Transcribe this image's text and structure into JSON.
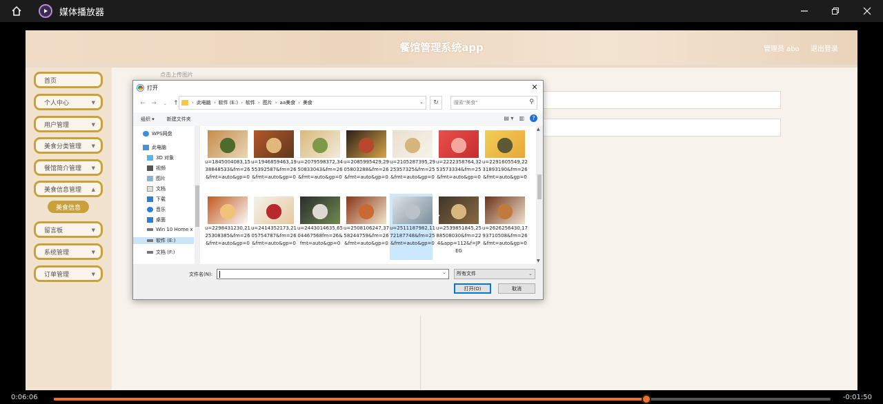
{
  "player": {
    "title": "媒体播放器",
    "time_elapsed": "0:06:06",
    "time_remaining": "-0:01:50",
    "progress": 0.763
  },
  "app": {
    "title": "餐馆管理系统app",
    "admin_label": "管理员 abo",
    "logout_label": "退出登录",
    "accent": "#c9a13a"
  },
  "sidebar": {
    "items": [
      {
        "label": "首页",
        "chevron": false
      },
      {
        "label": "个人中心",
        "chevron": true
      },
      {
        "label": "用户管理",
        "chevron": true
      },
      {
        "label": "美食分类管理",
        "chevron": true
      },
      {
        "label": "餐馆简介管理",
        "chevron": true
      },
      {
        "label": "美食信息管理",
        "chevron": true
      },
      {
        "label": "留言板",
        "chevron": true
      },
      {
        "label": "系统管理",
        "chevron": true
      },
      {
        "label": "订单管理",
        "chevron": true
      }
    ],
    "sub_item": "美食信息"
  },
  "main": {
    "crumb": "点击上传图片"
  },
  "dialog": {
    "title": "打开",
    "path": [
      "此电脑",
      "软件 (E:)",
      "软件",
      "图片",
      "aa美食",
      "美食"
    ],
    "search_placeholder": "搜索\"美食\"",
    "organize": "组织 ▾",
    "new_folder": "新建文件夹",
    "tree": [
      {
        "label": "WPS网盘",
        "icon": "cloud-icon"
      },
      {
        "label": "此电脑",
        "icon": "computer-icon"
      },
      {
        "label": "3D 对象",
        "icon": "cube-icon"
      },
      {
        "label": "视频",
        "icon": "video-icon"
      },
      {
        "label": "图片",
        "icon": "picture-icon"
      },
      {
        "label": "文档",
        "icon": "document-icon"
      },
      {
        "label": "下载",
        "icon": "download-icon"
      },
      {
        "label": "音乐",
        "icon": "music-icon"
      },
      {
        "label": "桌面",
        "icon": "desktop-icon"
      },
      {
        "label": "Win 10 Home x",
        "icon": "drive-icon"
      },
      {
        "label": "软件 (E:)",
        "icon": "drive-icon"
      },
      {
        "label": "文档 (F:)",
        "icon": "drive-icon"
      }
    ],
    "files": [
      {
        "name": "u=1845004083,1538848533&fm=26&fmt=auto&gp=0",
        "colors": [
          "#c78b4a",
          "#4e6b2e",
          "#e8d6b8"
        ]
      },
      {
        "name": "u=1946859463,1955392587&fm=26&fmt=auto&gp=0",
        "colors": [
          "#b5562a",
          "#e1b77a",
          "#5d3a1c"
        ]
      },
      {
        "name": "u=2079598372,3450833043&fm=26&fmt=auto&gp=0",
        "colors": [
          "#d9b97a",
          "#7e9a48",
          "#f3eadb"
        ]
      },
      {
        "name": "u=2085995429,2905803288&fm=26&fmt=auto&gp=0",
        "colors": [
          "#2a2016",
          "#b8482b",
          "#d9a24a"
        ]
      },
      {
        "name": "u=2105287395,2925357325&fm=25&fmt=auto&gp=0",
        "colors": [
          "#eae0cf",
          "#d7b57e",
          "#f7f3ea"
        ]
      },
      {
        "name": "u=2222358764,3253573334&fm=25&fmt=auto&gp=0",
        "colors": [
          "#e94f4b",
          "#f4a89b",
          "#c62e2e"
        ]
      },
      {
        "name": "u=2291605549,2231893190&fm=26&fmt=auto&gp=0",
        "colors": [
          "#f2cf55",
          "#5b5a34",
          "#e8a73a"
        ]
      },
      {
        "name": "u=2298431230,2125308385&fm=26&fmt=auto&gp=0",
        "colors": [
          "#c2591e",
          "#f0c27a",
          "#fafafa"
        ]
      },
      {
        "name": "u=2414352173,2105754787&fm=26&fmt=auto&gp=0",
        "colors": [
          "#f4f1ee",
          "#b8282c",
          "#e7c99e"
        ]
      },
      {
        "name": "u=2443014635,6504467568fm=26&fmt=auto&gp=0",
        "colors": [
          "#2b2b2e",
          "#dedad2",
          "#6f8a4f"
        ]
      },
      {
        "name": "u=2508106247,3758244759&fm=26&fmt=auto&gp=0",
        "colors": [
          "#8a3618",
          "#c96a32",
          "#f1e3cc"
        ]
      },
      {
        "name": "u=2511187982,1172187748&fm=25&fmt=auto&gp=0",
        "colors": [
          "#dfe3e6",
          "#b8c2c8",
          "#7b8f9b"
        ]
      },
      {
        "name": "u=2539851845,2588508030&fm=224&app=112&f=JPEG",
        "colors": [
          "#3f352a",
          "#d7b680",
          "#8a6a41"
        ]
      },
      {
        "name": "u=2626256430,1793710508&fm=26&fmt=auto&gp=0",
        "colors": [
          "#6e3318",
          "#c27a3c",
          "#efe2cf"
        ]
      }
    ],
    "filename_label": "文件名(N):",
    "filename_value": "",
    "filetype": "所有文件",
    "open_button": "打开(O)",
    "cancel_button": "取消"
  }
}
